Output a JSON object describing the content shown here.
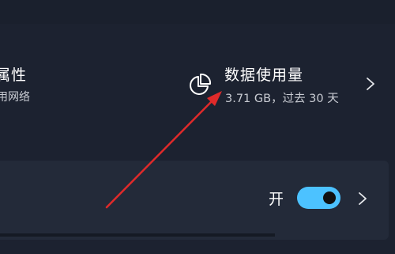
{
  "network": {
    "title": "属性",
    "subtitle": "用网络"
  },
  "data_usage": {
    "title": "数据使用量",
    "subtitle": "3.71 GB，过去 30 天",
    "icon": "pie-chart-icon"
  },
  "metered": {
    "toggle_label": "开",
    "toggle_state": "on",
    "accent_color": "#4cc2ff"
  },
  "annotation": {
    "arrow_color": "#e02a2a"
  }
}
